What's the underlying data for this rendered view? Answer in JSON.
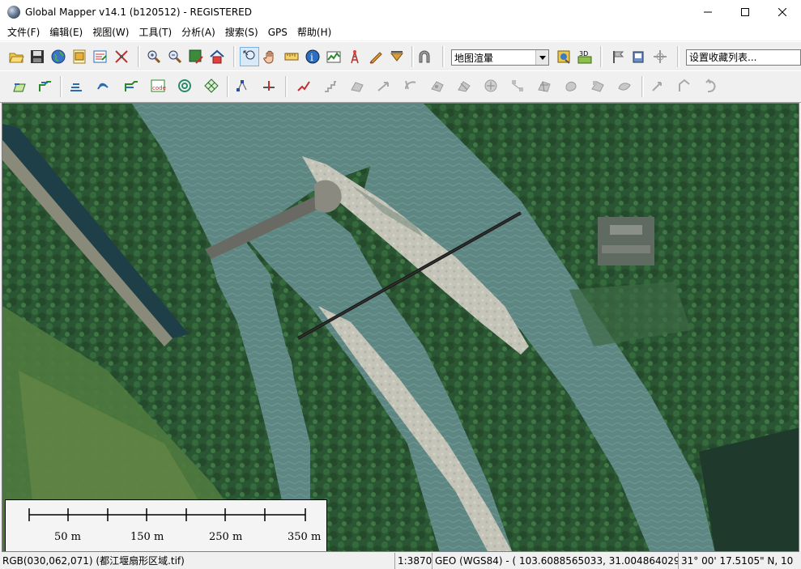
{
  "window": {
    "title": "Global Mapper v14.1 (b120512) - REGISTERED"
  },
  "menu": [
    "文件(F)",
    "编辑(E)",
    "视图(W)",
    "工具(T)",
    "分析(A)",
    "搜索(S)",
    "GPS",
    "帮助(H)"
  ],
  "toolbar": {
    "render_mode": "地图渲暈",
    "bookmark_placeholder": "设置收藏列表..."
  },
  "scale": {
    "labels": [
      "50 m",
      "150 m",
      "250 m",
      "350 m"
    ]
  },
  "status": {
    "pixel_info": "RGB(030,062,071) (都江堰扇形区域.tif)",
    "scale_ratio": "1:3870",
    "coords": "GEO (WGS84) - ( 103.6088565033, 31.0048640293 )",
    "dms": "31° 00' 17.5105\" N, 10"
  },
  "colors": {
    "river": "#5f8a87",
    "forest": "#2c5a33",
    "sandbar": "#c9c8bc"
  },
  "icons": [
    "open-icon",
    "save-icon",
    "globe-icon",
    "map-catalog-icon",
    "config-icon",
    "tools-icon",
    "zoom-in-icon",
    "zoom-out-icon",
    "full-view-icon",
    "home-icon",
    "zoom-tool-icon",
    "pan-icon",
    "measure-icon",
    "info-icon",
    "path-profile-icon",
    "radio-tower-icon",
    "digitizer-icon",
    "filter-icon",
    "arch-icon",
    "layer-control-icon",
    "3d-view-icon",
    "flag-icon",
    "print-icon",
    "crosshair-icon"
  ]
}
